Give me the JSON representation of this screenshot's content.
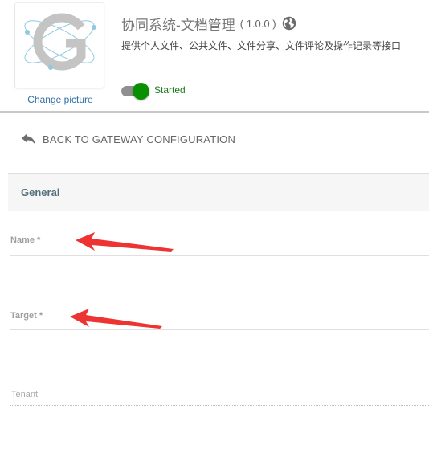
{
  "app": {
    "title": "协同系统-文档管理",
    "version": "( 1.0.0 )",
    "description": "提供个人文件、公共文件、文件分享、文件评论及操作记录等接口",
    "change_picture_label": "Change picture",
    "status_label": "Started",
    "started": true
  },
  "navigation": {
    "back_label": "BACK TO GATEWAY CONFIGURATION"
  },
  "section": {
    "title": "General"
  },
  "form": {
    "fields": [
      {
        "label": "Name *",
        "value": ""
      },
      {
        "label": "Target *",
        "value": ""
      },
      {
        "label": "Tenant",
        "value": ""
      }
    ]
  },
  "colors": {
    "status_green": "#0a8f00",
    "link_blue": "#2f6fa8",
    "annotation_red": "#ee3333"
  },
  "icons": [
    "logo-icon",
    "globe-icon",
    "back-arrow-icon"
  ]
}
